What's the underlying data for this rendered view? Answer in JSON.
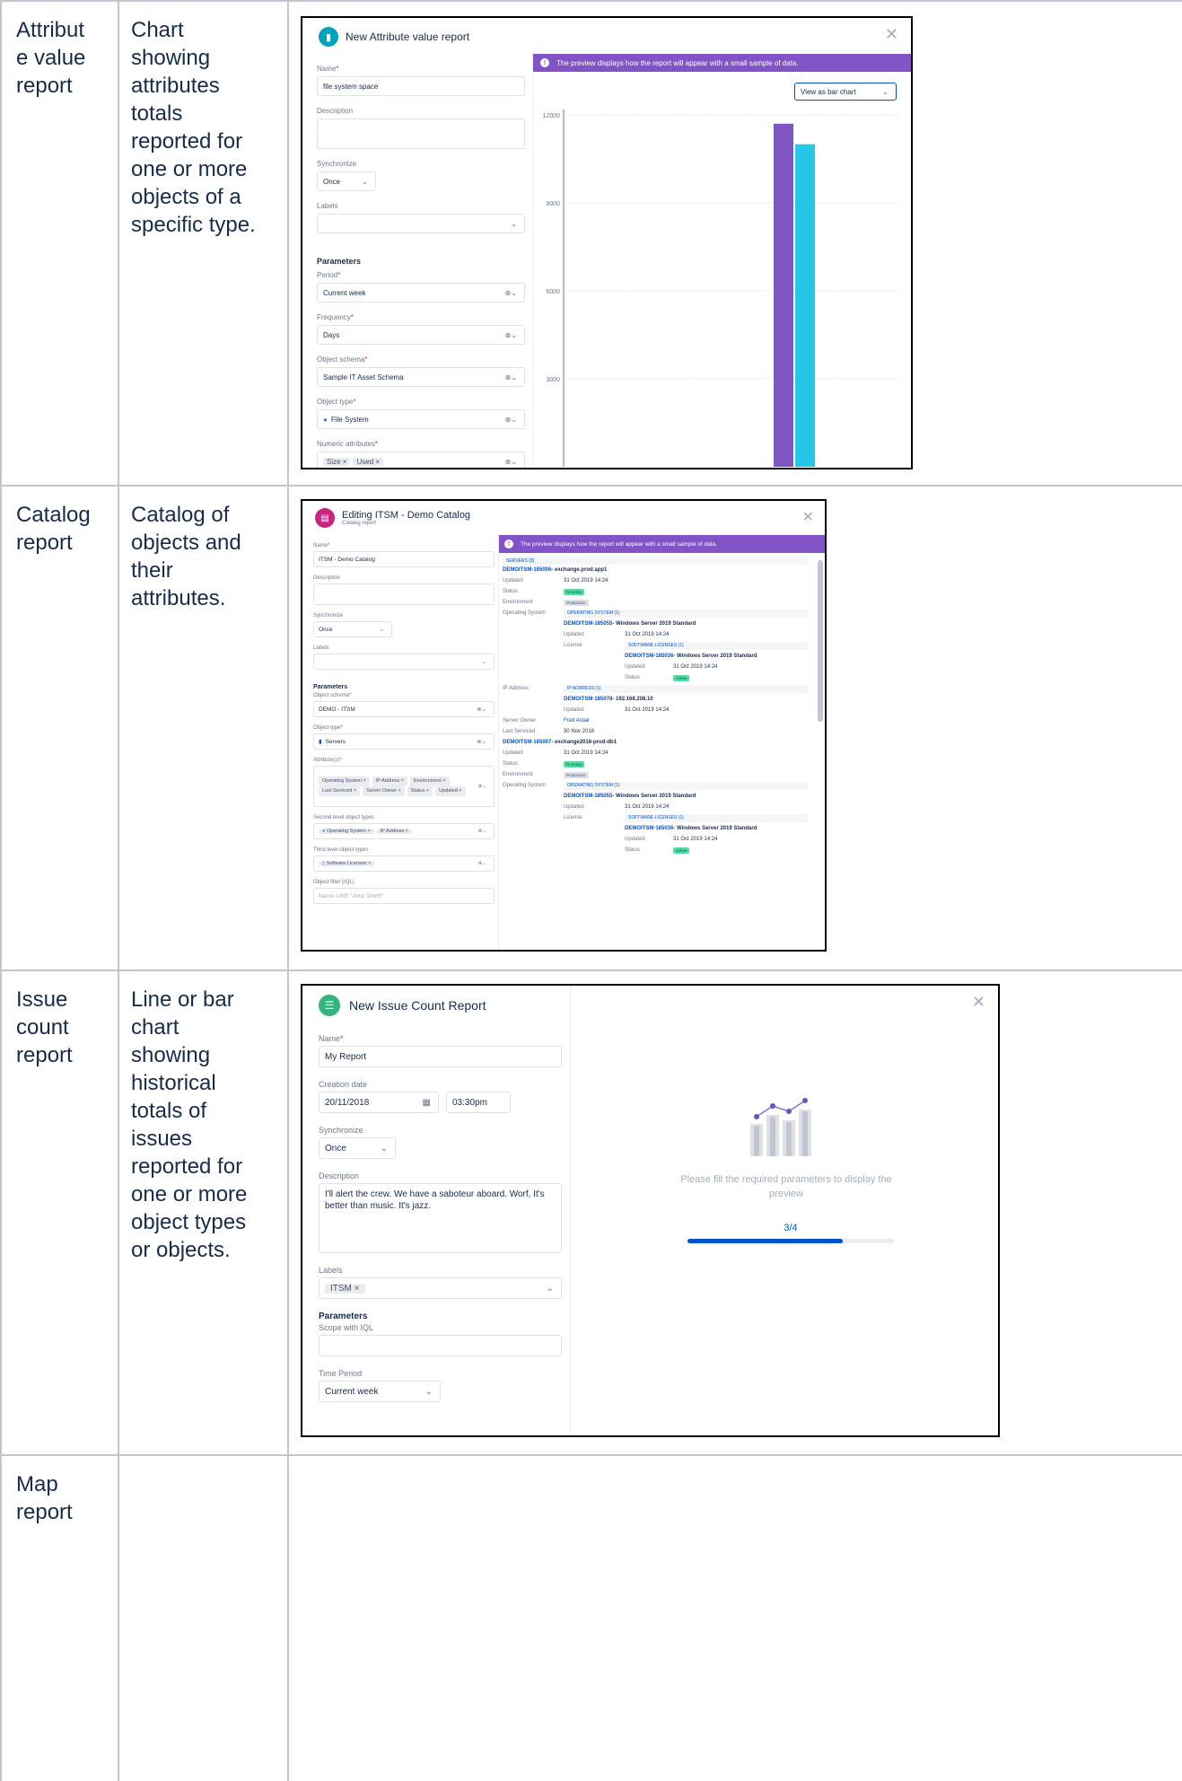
{
  "rows": [
    {
      "type": "Attribut\ne value\nreport",
      "description": "Chart\nshowing\nattributes\ntotals\nreported for\none or more\nobjects of a\nspecific type."
    },
    {
      "type": "Catalog\nreport",
      "description": "Catalog of\nobjects and\ntheir\nattributes."
    },
    {
      "type": "Issue\ncount\nreport",
      "description": "Line or bar\nchart\nshowing\nhistorical\ntotals of\nissues\nreported for\none or more\nobject types\nor objects."
    },
    {
      "type": "Map\nreport",
      "description": ""
    }
  ],
  "attr_report": {
    "title": "New Attribute value report",
    "name_label": "Name",
    "name_value": "file system space",
    "description_label": "Description",
    "synchronize_label": "Synchronize",
    "synchronize_value": "Once",
    "labels_label": "Labels",
    "parameters_heading": "Parameters",
    "period_label": "Period",
    "period_value": "Current week",
    "frequency_label": "Frequency",
    "frequency_value": "Days",
    "schema_label": "Object schema",
    "schema_value": "Sample IT Asset Schema",
    "object_type_label": "Object type",
    "object_type_value": "File System",
    "numeric_label": "Numeric attributes",
    "numeric_tags": [
      "Size",
      "Used"
    ],
    "banner": "The preview displays how the report will appear with a small sample of data.",
    "view_select": "View as bar chart",
    "chart_data": {
      "type": "bar",
      "categories": [
        ""
      ],
      "series": [
        {
          "name": "Size",
          "values": [
            11700
          ],
          "color": "#7e57c2"
        },
        {
          "name": "Used",
          "values": [
            11000
          ],
          "color": "#26c6e8"
        }
      ],
      "yticks": [
        "12000",
        "9000",
        "6000",
        "3000"
      ],
      "ylim": [
        0,
        12000
      ]
    }
  },
  "catalog_report": {
    "title": "Editing ITSM - Demo Catalog",
    "subtitle": "Catalog report",
    "name_label": "Name",
    "name_value": "ITSM - Demo Catalog",
    "description_label": "Description",
    "synchronize_label": "Synchronize",
    "synchronize_value": "Once",
    "labels_label": "Labels",
    "parameters_heading": "Parameters",
    "schema_label": "Object schema",
    "schema_value": "DEMO - ITSM",
    "object_type_label": "Object type",
    "object_type_value": "Servers",
    "attributes_label": "Attribute(s)",
    "attribute_tags": [
      "Operating System",
      "IP Address",
      "Environment",
      "Last Serviced",
      "Server Owner",
      "Status",
      "Updated"
    ],
    "second_level_label": "Second level object types",
    "second_level_tags": [
      "Operating System",
      "IP Address"
    ],
    "third_level_label": "Third level object types",
    "third_level_tags": [
      "Software Licenses"
    ],
    "filter_label": "Object filter (IQL)",
    "filter_placeholder": "Name LIKE \"John Smith\"",
    "banner": "The preview displays how the report will appear with a small sample of data.",
    "servers_head": "SERVERS (8)",
    "server1_key": "DEMOITSM-185006",
    "server1_name": " - exchange.prod.app1",
    "updated_label": "Updated",
    "date_value": "31 Oct 2019 14:24",
    "status_label": "Status",
    "status_running": "Running",
    "status_active": "Active",
    "environment_label": "Environment",
    "environment_value": "Production",
    "os_label": "Operating System",
    "os_head": "OPERATING SYSTEM (1)",
    "os_key": "DEMOITSM-185055",
    "os_name": " - Windows Server 2019 Standard",
    "license_label": "License",
    "license_head": "SOFTWARE LICENSES (1)",
    "license_key": "DEMOITSM-185036",
    "license_name": " - Windows Server 2019 Standard",
    "ip_label": "IP Address",
    "ip_head": "IP ADDRESS (1)",
    "ip_key": "DEMOITSM-185078",
    "ip_name": " - 192.168.208.10",
    "owner_label": "Server Owner",
    "owner_value": "Fred Astair",
    "last_serviced_label": "Last Serviced",
    "last_serviced_value": "30 Nov 2018",
    "server2_key": "DEMOITSM-185007",
    "server2_name": " - exchange2016-prod-db1"
  },
  "issue_report": {
    "title": "New Issue Count Report",
    "name_label": "Name",
    "name_value": "My Report",
    "creation_label": "Creation date",
    "date_value": "20/11/2018",
    "time_value": "03:30pm",
    "synchronize_label": "Synchronize",
    "synchronize_value": "Once",
    "description_label": "Description",
    "description_value": "I'll alert the crew. We have a saboteur aboard. Worf, It's better than music. It's jazz.",
    "labels_label": "Labels",
    "labels_tag": "ITSM",
    "parameters_heading": "Parameters",
    "scope_label": "Scope with IQL",
    "period_label": "Time Period",
    "period_value": "Current week",
    "placeholder_msg": "Please fill the required parameters to display the preview",
    "progress_text": "3/4",
    "progress_fraction": 0.75
  }
}
